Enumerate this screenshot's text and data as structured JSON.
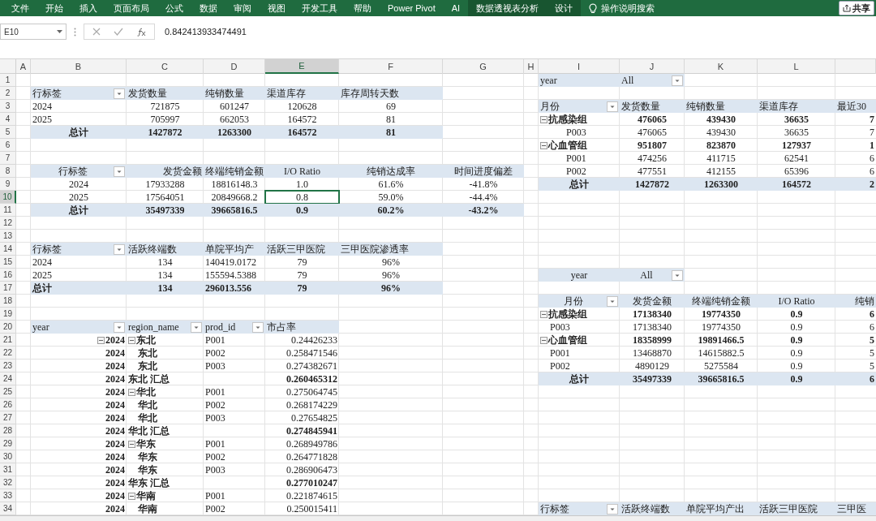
{
  "ribbon": {
    "tabs": [
      {
        "label": "文件",
        "contextual": false
      },
      {
        "label": "开始",
        "contextual": false
      },
      {
        "label": "插入",
        "contextual": false
      },
      {
        "label": "页面布局",
        "contextual": false
      },
      {
        "label": "公式",
        "contextual": false
      },
      {
        "label": "数据",
        "contextual": false
      },
      {
        "label": "审阅",
        "contextual": false
      },
      {
        "label": "视图",
        "contextual": false
      },
      {
        "label": "开发工具",
        "contextual": false
      },
      {
        "label": "帮助",
        "contextual": false
      },
      {
        "label": "Power Pivot",
        "contextual": false
      },
      {
        "label": "AI",
        "contextual": false
      },
      {
        "label": "数据透视表分析",
        "contextual": true
      },
      {
        "label": "设计",
        "contextual": true
      }
    ],
    "search": "操作说明搜索",
    "share": "共享"
  },
  "formula_bar": {
    "name_box": "E10",
    "value": "0.842413933474491"
  },
  "sheet": {
    "columns": [
      {
        "label": "A",
        "selected": false
      },
      {
        "label": "B",
        "selected": false
      },
      {
        "label": "C",
        "selected": false
      },
      {
        "label": "D",
        "selected": false
      },
      {
        "label": "E",
        "selected": true
      },
      {
        "label": "F",
        "selected": false
      },
      {
        "label": "G",
        "selected": false
      },
      {
        "label": "H",
        "selected": false
      },
      {
        "label": "I",
        "selected": false
      },
      {
        "label": "J",
        "selected": false
      },
      {
        "label": "K",
        "selected": false
      },
      {
        "label": "L",
        "selected": false
      }
    ],
    "rows": [
      {
        "number": "1",
        "selected": false,
        "cells": [
          {
            "kind": "blank"
          },
          {
            "kind": "blank"
          },
          {
            "kind": "blank"
          },
          {
            "kind": "blank"
          },
          {
            "kind": "blank"
          },
          {
            "kind": "blank"
          },
          {
            "kind": "blank"
          },
          {
            "kind": "blank"
          },
          {
            "text": "year",
            "kind": "heading"
          },
          {
            "text": "All",
            "kind": "filter"
          }
        ]
      },
      {
        "number": "2",
        "selected": false,
        "cells": [
          {
            "kind": "blank"
          },
          {
            "text": "行标签",
            "kind": "filter"
          },
          {
            "text": "发货数量",
            "kind": "heading"
          },
          {
            "text": "纯销数量",
            "kind": "heading"
          },
          {
            "text": "渠道库存",
            "kind": "heading"
          },
          {
            "text": "库存周转天数",
            "kind": "heading"
          }
        ]
      },
      {
        "number": "3",
        "selected": false,
        "cells": [
          {
            "kind": "blank"
          },
          {
            "text": "2024",
            "kind": "label"
          },
          {
            "text": "721875",
            "kind": "value"
          },
          {
            "text": "601247",
            "kind": "value"
          },
          {
            "text": "120628",
            "kind": "value"
          },
          {
            "text": "69",
            "kind": "value"
          },
          {
            "kind": "blank"
          },
          {
            "kind": "blank"
          },
          {
            "text": "月份",
            "kind": "filter"
          },
          {
            "text": "发货数量",
            "kind": "heading"
          },
          {
            "text": "纯销数量",
            "kind": "heading"
          },
          {
            "text": "渠道库存",
            "kind": "heading"
          },
          {
            "text": "最近30",
            "kind": "heading"
          }
        ]
      },
      {
        "number": "4",
        "selected": false,
        "cells": [
          {
            "kind": "blank"
          },
          {
            "text": "2025",
            "kind": "label"
          },
          {
            "text": "705997",
            "kind": "value"
          },
          {
            "text": "662053",
            "kind": "value"
          },
          {
            "text": "164572",
            "kind": "value"
          },
          {
            "text": "81",
            "kind": "value"
          },
          {
            "kind": "blank"
          },
          {
            "kind": "blank"
          },
          {
            "text": "抗感染组",
            "kind": "branch"
          },
          {
            "text": "476065",
            "kind": "boldvalue"
          },
          {
            "text": "439430",
            "kind": "boldvalue"
          },
          {
            "text": "36635",
            "kind": "boldvalue"
          },
          {
            "text": "7",
            "kind": "boldnumber"
          }
        ]
      },
      {
        "number": "5",
        "selected": false,
        "cells": [
          {
            "kind": "blank"
          },
          {
            "text": "总计",
            "kind": "total"
          },
          {
            "text": "1427872",
            "kind": "total"
          },
          {
            "text": "1263300",
            "kind": "total"
          },
          {
            "text": "164572",
            "kind": "total"
          },
          {
            "text": "81",
            "kind": "total"
          },
          {
            "kind": "blank"
          },
          {
            "kind": "blank"
          },
          {
            "text": "P003",
            "kind": "deepchild"
          },
          {
            "text": "476065",
            "kind": "value"
          },
          {
            "text": "439430",
            "kind": "value"
          },
          {
            "text": "36635",
            "kind": "value"
          },
          {
            "text": "7",
            "kind": "number"
          }
        ]
      },
      {
        "number": "6",
        "selected": false,
        "cells": [
          {
            "kind": "blank"
          },
          {
            "kind": "blank"
          },
          {
            "kind": "blank"
          },
          {
            "kind": "blank"
          },
          {
            "kind": "blank"
          },
          {
            "kind": "blank"
          },
          {
            "kind": "blank"
          },
          {
            "kind": "blank"
          },
          {
            "text": "心血管组",
            "kind": "branch"
          },
          {
            "text": "951807",
            "kind": "boldvalue"
          },
          {
            "text": "823870",
            "kind": "boldvalue"
          },
          {
            "text": "127937",
            "kind": "boldvalue"
          },
          {
            "text": "1",
            "kind": "boldnumber"
          }
        ]
      },
      {
        "number": "7",
        "selected": false,
        "cells": [
          {
            "kind": "blank"
          },
          {
            "kind": "blank"
          },
          {
            "kind": "blank"
          },
          {
            "kind": "blank"
          },
          {
            "kind": "blank"
          },
          {
            "kind": "blank"
          },
          {
            "kind": "blank"
          },
          {
            "kind": "blank"
          },
          {
            "text": "P001",
            "kind": "deepchild"
          },
          {
            "text": "474256",
            "kind": "value"
          },
          {
            "text": "411715",
            "kind": "value"
          },
          {
            "text": "62541",
            "kind": "value"
          },
          {
            "text": "6",
            "kind": "number"
          }
        ]
      },
      {
        "number": "8",
        "selected": false,
        "cells": [
          {
            "kind": "blank"
          },
          {
            "text": "行标签",
            "kind": "centerfilter"
          },
          {
            "text": "发货金额",
            "kind": "rightheading"
          },
          {
            "text": "终端纯销金额",
            "kind": "centerheading"
          },
          {
            "text": "I/O Ratio",
            "kind": "centerheading"
          },
          {
            "text": "纯销达成率",
            "kind": "centerheading"
          },
          {
            "text": "时间进度偏差",
            "kind": "centerheading"
          },
          {
            "kind": "blank"
          },
          {
            "text": "P002",
            "kind": "deepchild"
          },
          {
            "text": "477551",
            "kind": "value"
          },
          {
            "text": "412155",
            "kind": "value"
          },
          {
            "text": "65396",
            "kind": "value"
          },
          {
            "text": "6",
            "kind": "number"
          }
        ]
      },
      {
        "number": "9",
        "selected": false,
        "cells": [
          {
            "kind": "blank"
          },
          {
            "text": "2024",
            "kind": "value"
          },
          {
            "text": "17933288",
            "kind": "value"
          },
          {
            "text": "18816148.3",
            "kind": "value"
          },
          {
            "text": "1.0",
            "kind": "value"
          },
          {
            "text": "61.6%",
            "kind": "value"
          },
          {
            "text": "-41.8%",
            "kind": "value"
          },
          {
            "kind": "blank"
          },
          {
            "text": "总计",
            "kind": "total"
          },
          {
            "text": "1427872",
            "kind": "total"
          },
          {
            "text": "1263300",
            "kind": "total"
          },
          {
            "text": "164572",
            "kind": "total"
          },
          {
            "text": "2",
            "kind": "righttotal"
          }
        ]
      },
      {
        "number": "10",
        "selected": true,
        "cells": [
          {
            "kind": "blank"
          },
          {
            "text": "2025",
            "kind": "value"
          },
          {
            "text": "17564051",
            "kind": "value"
          },
          {
            "text": "20849668.2",
            "kind": "value"
          },
          {
            "text": "0.8",
            "kind": "value"
          },
          {
            "text": "59.0%",
            "kind": "value"
          },
          {
            "text": "-44.4%",
            "kind": "value"
          }
        ]
      },
      {
        "number": "11",
        "selected": false,
        "cells": [
          {
            "kind": "blank"
          },
          {
            "text": "总计",
            "kind": "total"
          },
          {
            "text": "35497339",
            "kind": "total"
          },
          {
            "text": "39665816.5",
            "kind": "total"
          },
          {
            "text": "0.9",
            "kind": "total"
          },
          {
            "text": "60.2%",
            "kind": "total"
          },
          {
            "text": "-43.2%",
            "kind": "total"
          }
        ]
      },
      {
        "number": "12",
        "selected": false
      },
      {
        "number": "13",
        "selected": false
      },
      {
        "number": "14",
        "selected": false,
        "cells": [
          {
            "kind": "blank"
          },
          {
            "text": "行标签",
            "kind": "filter"
          },
          {
            "text": "活跃终端数",
            "kind": "heading"
          },
          {
            "text": "单院平均产",
            "kind": "heading"
          },
          {
            "text": "活跃三甲医院",
            "kind": "heading"
          },
          {
            "text": "三甲医院渗透率",
            "kind": "heading"
          }
        ]
      },
      {
        "number": "15",
        "selected": false,
        "cells": [
          {
            "kind": "blank"
          },
          {
            "text": "2024",
            "kind": "label"
          },
          {
            "text": "134",
            "kind": "value"
          },
          {
            "text": "140419.0172",
            "kind": "label"
          },
          {
            "text": "79",
            "kind": "value"
          },
          {
            "text": "96%",
            "kind": "value"
          }
        ]
      },
      {
        "number": "16",
        "selected": false,
        "cells": [
          {
            "kind": "blank"
          },
          {
            "text": "2025",
            "kind": "label"
          },
          {
            "text": "134",
            "kind": "value"
          },
          {
            "text": "155594.5388",
            "kind": "label"
          },
          {
            "text": "79",
            "kind": "value"
          },
          {
            "text": "96%",
            "kind": "value"
          },
          {
            "kind": "blank"
          },
          {
            "kind": "blank"
          },
          {
            "text": "year",
            "kind": "centerheading"
          },
          {
            "text": "All",
            "kind": "centerfilter"
          }
        ]
      },
      {
        "number": "17",
        "selected": false,
        "cells": [
          {
            "kind": "blank"
          },
          {
            "text": "总计",
            "kind": "lefttotal"
          },
          {
            "text": "134",
            "kind": "total"
          },
          {
            "text": "296013.556",
            "kind": "lefttotal"
          },
          {
            "text": "79",
            "kind": "total"
          },
          {
            "text": "96%",
            "kind": "total"
          }
        ]
      },
      {
        "number": "18",
        "selected": false,
        "cells": [
          {
            "kind": "blank"
          },
          {
            "kind": "blank"
          },
          {
            "kind": "blank"
          },
          {
            "kind": "blank"
          },
          {
            "kind": "blank"
          },
          {
            "kind": "blank"
          },
          {
            "kind": "blank"
          },
          {
            "kind": "blank"
          },
          {
            "text": "月份",
            "kind": "centerfilter"
          },
          {
            "text": "发货金额",
            "kind": "centerheading"
          },
          {
            "text": "终端纯销金额",
            "kind": "centerheading"
          },
          {
            "text": "I/O Ratio",
            "kind": "centerheading"
          },
          {
            "text": "纯销",
            "kind": "rightheading"
          }
        ]
      },
      {
        "number": "19",
        "selected": false,
        "cells": [
          {
            "kind": "blank"
          },
          {
            "kind": "blank"
          },
          {
            "kind": "blank"
          },
          {
            "kind": "blank"
          },
          {
            "kind": "blank"
          },
          {
            "kind": "blank"
          },
          {
            "kind": "blank"
          },
          {
            "kind": "blank"
          },
          {
            "text": "抗感染组",
            "kind": "branch"
          },
          {
            "text": "17138340",
            "kind": "boldvalue"
          },
          {
            "text": "19774350",
            "kind": "boldvalue"
          },
          {
            "text": "0.9",
            "kind": "boldvalue"
          },
          {
            "text": "6",
            "kind": "boldnumber"
          }
        ]
      },
      {
        "number": "20",
        "selected": false,
        "cells": [
          {
            "kind": "blank"
          },
          {
            "text": "year",
            "kind": "filter"
          },
          {
            "text": "region_name",
            "kind": "filter"
          },
          {
            "text": "prod_id",
            "kind": "filter"
          },
          {
            "text": "市占率",
            "kind": "heading"
          },
          {
            "kind": "blank"
          },
          {
            "kind": "blank"
          },
          {
            "kind": "blank"
          },
          {
            "text": "P003",
            "kind": "child"
          },
          {
            "text": "17138340",
            "kind": "value"
          },
          {
            "text": "19774350",
            "kind": "value"
          },
          {
            "text": "0.9",
            "kind": "value"
          },
          {
            "text": "6",
            "kind": "number"
          }
        ]
      },
      {
        "number": "21",
        "selected": false,
        "cells": [
          {
            "kind": "blank"
          },
          {
            "text": "2024",
            "kind": "rightbranch"
          },
          {
            "text": "东北",
            "kind": "branch"
          },
          {
            "text": "P001",
            "kind": "label"
          },
          {
            "text": "0.24426233",
            "kind": "number"
          },
          {
            "kind": "blank"
          },
          {
            "kind": "blank"
          },
          {
            "kind": "blank"
          },
          {
            "text": "心血管组",
            "kind": "branch"
          },
          {
            "text": "18358999",
            "kind": "boldvalue"
          },
          {
            "text": "19891466.5",
            "kind": "boldvalue"
          },
          {
            "text": "0.9",
            "kind": "boldvalue"
          },
          {
            "text": "5",
            "kind": "boldnumber"
          }
        ]
      },
      {
        "number": "22",
        "selected": false,
        "cells": [
          {
            "kind": "blank"
          },
          {
            "text": "2024",
            "kind": "boldnumber"
          },
          {
            "text": "东北",
            "kind": "boldchild"
          },
          {
            "text": "P002",
            "kind": "label"
          },
          {
            "text": "0.258471546",
            "kind": "number"
          },
          {
            "kind": "blank"
          },
          {
            "kind": "blank"
          },
          {
            "kind": "blank"
          },
          {
            "text": "P001",
            "kind": "child"
          },
          {
            "text": "13468870",
            "kind": "value"
          },
          {
            "text": "14615882.5",
            "kind": "value"
          },
          {
            "text": "0.9",
            "kind": "value"
          },
          {
            "text": "5",
            "kind": "number"
          }
        ]
      },
      {
        "number": "23",
        "selected": false,
        "cells": [
          {
            "kind": "blank"
          },
          {
            "text": "2024",
            "kind": "boldnumber"
          },
          {
            "text": "东北",
            "kind": "boldchild"
          },
          {
            "text": "P003",
            "kind": "label"
          },
          {
            "text": "0.274382671",
            "kind": "number"
          },
          {
            "kind": "blank"
          },
          {
            "kind": "blank"
          },
          {
            "kind": "blank"
          },
          {
            "text": "P002",
            "kind": "child"
          },
          {
            "text": "4890129",
            "kind": "value"
          },
          {
            "text": "5275584",
            "kind": "value"
          },
          {
            "text": "0.9",
            "kind": "value"
          },
          {
            "text": "5",
            "kind": "number"
          }
        ]
      },
      {
        "number": "24",
        "selected": false,
        "cells": [
          {
            "kind": "blank"
          },
          {
            "text": "2024",
            "kind": "boldnumber"
          },
          {
            "text": "东北 汇总",
            "kind": "subtotal"
          },
          {
            "kind": "blank"
          },
          {
            "text": "0.260465312",
            "kind": "boldnumber"
          },
          {
            "kind": "blank"
          },
          {
            "kind": "blank"
          },
          {
            "kind": "blank"
          },
          {
            "text": "总计",
            "kind": "total"
          },
          {
            "text": "35497339",
            "kind": "total"
          },
          {
            "text": "39665816.5",
            "kind": "total"
          },
          {
            "text": "0.9",
            "kind": "total"
          },
          {
            "text": "6",
            "kind": "righttotal"
          }
        ]
      },
      {
        "number": "25",
        "selected": false,
        "cells": [
          {
            "kind": "blank"
          },
          {
            "text": "2024",
            "kind": "boldnumber"
          },
          {
            "text": "华北",
            "kind": "branch"
          },
          {
            "text": "P001",
            "kind": "label"
          },
          {
            "text": "0.275064745",
            "kind": "number"
          }
        ]
      },
      {
        "number": "26",
        "selected": false,
        "cells": [
          {
            "kind": "blank"
          },
          {
            "text": "2024",
            "kind": "boldnumber"
          },
          {
            "text": "华北",
            "kind": "boldchild"
          },
          {
            "text": "P002",
            "kind": "label"
          },
          {
            "text": "0.268174229",
            "kind": "number"
          }
        ]
      },
      {
        "number": "27",
        "selected": false,
        "cells": [
          {
            "kind": "blank"
          },
          {
            "text": "2024",
            "kind": "boldnumber"
          },
          {
            "text": "华北",
            "kind": "boldchild"
          },
          {
            "text": "P003",
            "kind": "label"
          },
          {
            "text": "0.27654825",
            "kind": "number"
          }
        ]
      },
      {
        "number": "28",
        "selected": false,
        "cells": [
          {
            "kind": "blank"
          },
          {
            "text": "2024",
            "kind": "boldnumber"
          },
          {
            "text": "华北 汇总",
            "kind": "subtotal"
          },
          {
            "kind": "blank"
          },
          {
            "text": "0.274845941",
            "kind": "boldnumber"
          }
        ]
      },
      {
        "number": "29",
        "selected": false,
        "cells": [
          {
            "kind": "blank"
          },
          {
            "text": "2024",
            "kind": "boldnumber"
          },
          {
            "text": "华东",
            "kind": "branch"
          },
          {
            "text": "P001",
            "kind": "label"
          },
          {
            "text": "0.268949786",
            "kind": "number"
          }
        ]
      },
      {
        "number": "30",
        "selected": false,
        "cells": [
          {
            "kind": "blank"
          },
          {
            "text": "2024",
            "kind": "boldnumber"
          },
          {
            "text": "华东",
            "kind": "boldchild"
          },
          {
            "text": "P002",
            "kind": "label"
          },
          {
            "text": "0.264771828",
            "kind": "number"
          }
        ]
      },
      {
        "number": "31",
        "selected": false,
        "cells": [
          {
            "kind": "blank"
          },
          {
            "text": "2024",
            "kind": "boldnumber"
          },
          {
            "text": "华东",
            "kind": "boldchild"
          },
          {
            "text": "P003",
            "kind": "label"
          },
          {
            "text": "0.286906473",
            "kind": "number"
          }
        ]
      },
      {
        "number": "32",
        "selected": false,
        "cells": [
          {
            "kind": "blank"
          },
          {
            "text": "2024",
            "kind": "boldnumber"
          },
          {
            "text": "华东 汇总",
            "kind": "subtotal"
          },
          {
            "kind": "blank"
          },
          {
            "text": "0.277010247",
            "kind": "boldnumber"
          }
        ]
      },
      {
        "number": "33",
        "selected": false,
        "cells": [
          {
            "kind": "blank"
          },
          {
            "text": "2024",
            "kind": "boldnumber"
          },
          {
            "text": "华南",
            "kind": "branch"
          },
          {
            "text": "P001",
            "kind": "label"
          },
          {
            "text": "0.221874615",
            "kind": "number"
          }
        ]
      },
      {
        "number": "34",
        "selected": false,
        "cells": [
          {
            "kind": "blank"
          },
          {
            "text": "2024",
            "kind": "boldnumber"
          },
          {
            "text": "华南",
            "kind": "boldchild"
          },
          {
            "text": "P002",
            "kind": "label"
          },
          {
            "text": "0.250015411",
            "kind": "number"
          },
          {
            "kind": "blank"
          },
          {
            "kind": "blank"
          },
          {
            "kind": "blank"
          },
          {
            "text": "行标签",
            "kind": "filter"
          },
          {
            "text": "活跃终端数",
            "kind": "heading"
          },
          {
            "text": "单院平均产出",
            "kind": "heading"
          },
          {
            "text": "活跃三甲医院",
            "kind": "heading"
          },
          {
            "text": "三甲医",
            "kind": "heading"
          }
        ]
      }
    ]
  }
}
